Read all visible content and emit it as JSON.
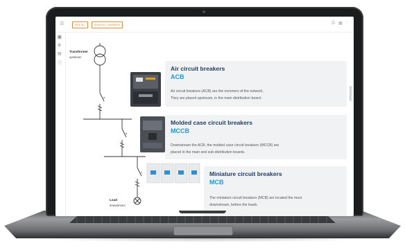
{
  "toolbar": {
    "menu_icon": "menu-icon",
    "btn1": "HIDE ALL",
    "btn2": "SHOW ALL / NUMBERS",
    "right_icons": [
      "print-icon",
      "grid-icon",
      "user-icon"
    ]
  },
  "sidebar": {
    "icons": [
      "home-icon",
      "settings-icon",
      "document-icon",
      "info-icon"
    ]
  },
  "diagram": {
    "transformer_label": "Transformer",
    "transformer_sub": "upstream",
    "load_label": "Load",
    "load_sub": "downstream",
    "breaker_marks": [
      "a",
      "b",
      "c",
      "d"
    ]
  },
  "cards": [
    {
      "title": "Air circuit breakers",
      "abbr": "ACB",
      "desc_lines": [
        "Air circuit breakers (ACB) are the incomers of the network.",
        "They are placed upstream, in the main distribution board."
      ]
    },
    {
      "title": "Molded case circuit breakers",
      "abbr": "MCCB",
      "desc_lines": [
        "Downstream the ACB, the molded case circuit breakers (MCCB) are",
        "placed in the main and sub-distribution boards."
      ]
    },
    {
      "title": "Miniature circuit breakers",
      "abbr": "MCB",
      "desc_lines": [
        "The miniature circuit breakers (MCB) are located the most",
        "downstream, before the loads."
      ]
    }
  ],
  "colors": {
    "accent": "#1a9ad6",
    "title": "#1e3a5f",
    "button_outline": "#e08a3a",
    "card_bg": "#f1f2f4"
  }
}
